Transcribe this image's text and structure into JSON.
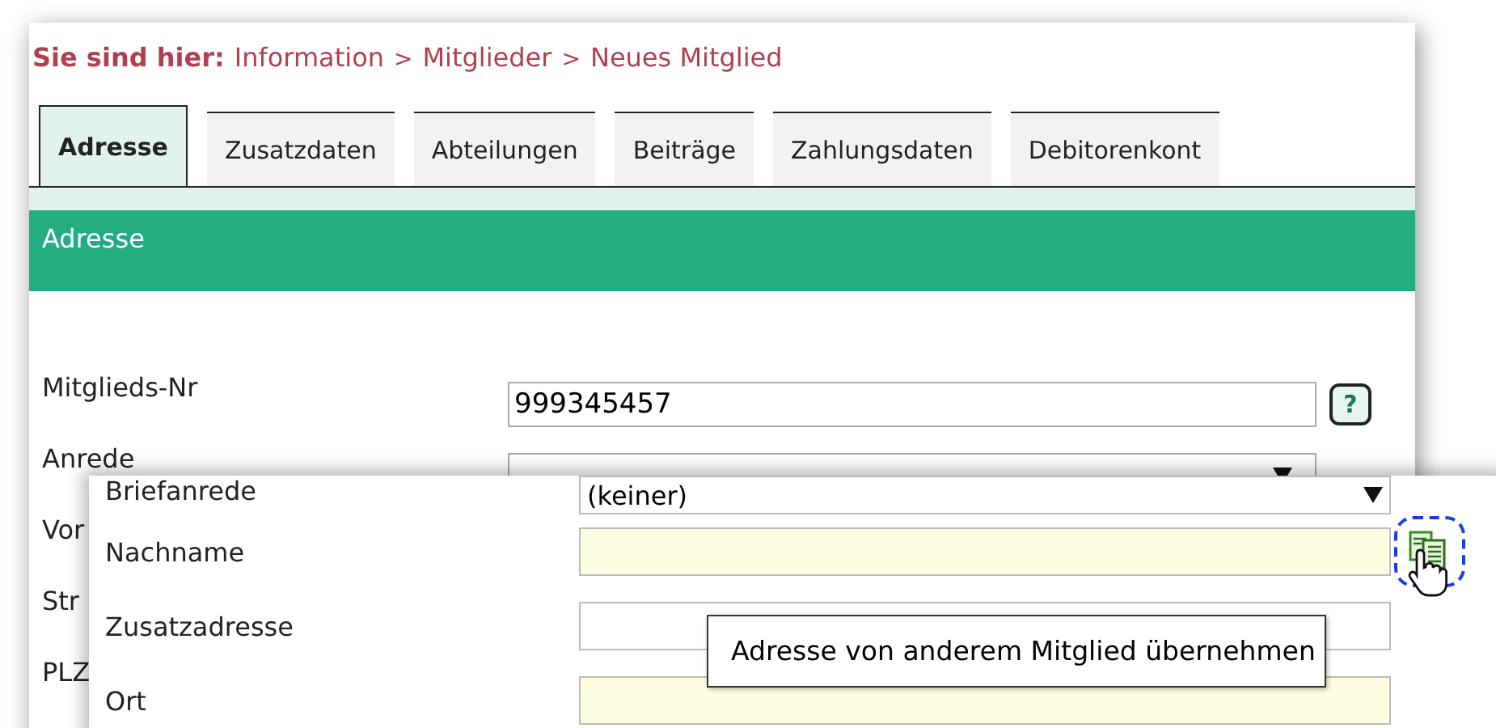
{
  "breadcrumb": {
    "label": "Sie sind hier:",
    "crumbs": [
      {
        "kind": "link",
        "text": "Information"
      },
      {
        "kind": "sep",
        "text": ">"
      },
      {
        "kind": "link",
        "text": "Mitglieder"
      },
      {
        "kind": "sep",
        "text": ">"
      },
      {
        "kind": "link",
        "text": "Neues Mitglied"
      }
    ]
  },
  "tabs": [
    {
      "label": "Adresse",
      "selected": true
    },
    {
      "label": "Zusatzdaten",
      "selected": false
    },
    {
      "label": "Abteilungen",
      "selected": false
    },
    {
      "label": "Beiträge",
      "selected": false
    },
    {
      "label": "Zahlungsdaten",
      "selected": false
    },
    {
      "label": "Debitorenkont",
      "selected": false
    }
  ],
  "section_title": "Adresse",
  "back_fields": [
    {
      "label": "Mitglieds-Nr",
      "kind": "text",
      "value": "999345457",
      "help": "?"
    },
    {
      "label": "Anrede",
      "kind": "select"
    },
    {
      "label": "Vor",
      "kind": "covered"
    },
    {
      "label": "Str",
      "kind": "covered"
    },
    {
      "label": "PLZ",
      "kind": "covered"
    }
  ],
  "front_fields": [
    {
      "label": "Briefanrede",
      "kind": "select",
      "value": "(keiner)",
      "required": false
    },
    {
      "label": "Nachname",
      "kind": "text",
      "required": true,
      "copy_button": true
    },
    {
      "label": "Zusatzadresse",
      "kind": "text",
      "required": false
    },
    {
      "label": "Ort",
      "kind": "text",
      "required": true
    }
  ],
  "tooltip": "Adresse von anderem Mitglied übernehmen"
}
